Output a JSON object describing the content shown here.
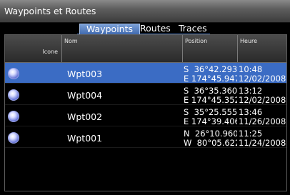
{
  "window": {
    "title": "Waypoints et Routes"
  },
  "tabs": [
    {
      "label": "Waypoints",
      "active": true
    },
    {
      "label": "Routes",
      "active": false
    },
    {
      "label": "Traces",
      "active": false
    }
  ],
  "table": {
    "headers": {
      "icon": "Icone",
      "name": "Nom",
      "position": "Position",
      "time": "Heure"
    },
    "rows": [
      {
        "name": "Wpt003",
        "lat": "S  36°42.293'",
        "lon": "E 174°45.947'",
        "time": "10:48",
        "date": "12/02/2008",
        "selected": true
      },
      {
        "name": "Wpt004",
        "lat": "S  36°35.360'",
        "lon": "E 174°45.352'",
        "time": "13:12",
        "date": "12/02/2008",
        "selected": false
      },
      {
        "name": "Wpt002",
        "lat": "S  35°25.555'",
        "lon": "E 174°39.406'",
        "time": "13:46",
        "date": "11/26/2008",
        "selected": false
      },
      {
        "name": "Wpt001",
        "lat": "N  26°10.960'",
        "lon": "W  80°05.622'",
        "time": "11:25",
        "date": "11/24/2008",
        "selected": false
      }
    ]
  },
  "colors": {
    "selection": "#3b6cc4",
    "tab_active": "#4a74bd",
    "waypoint_icon": "#7a88e0"
  },
  "icons": {
    "waypoint": "waypoint-circle-icon"
  }
}
